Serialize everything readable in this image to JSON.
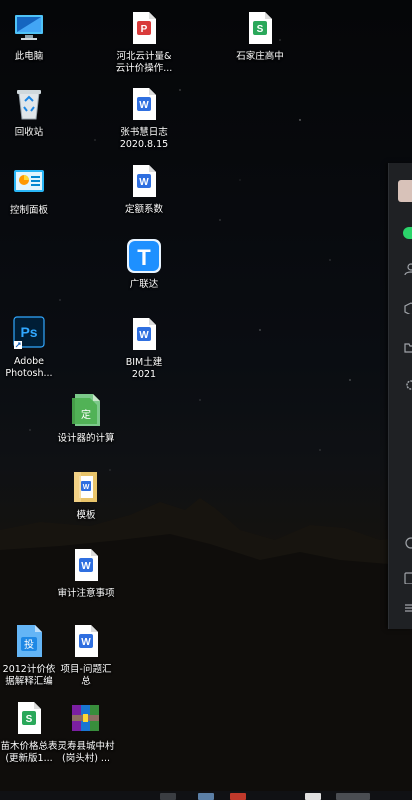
{
  "desktop": {
    "icons": [
      {
        "id": "this-pc",
        "label": "此电脑"
      },
      {
        "id": "recycle-bin",
        "label": "回收站"
      },
      {
        "id": "control-panel",
        "label": "控制面板"
      },
      {
        "id": "photoshop",
        "label": "Adobe\nPhotosh..."
      },
      {
        "id": "hebei-cloud",
        "label": "河北云计量&\n云计价操作..."
      },
      {
        "id": "zhang-log",
        "label": "张书慧日志\n2020.8.15"
      },
      {
        "id": "quota-coef",
        "label": "定额系数"
      },
      {
        "id": "glodon",
        "label": "广联达"
      },
      {
        "id": "bim",
        "label": "BIM土建\n2021"
      },
      {
        "id": "design-calc",
        "label": "设计器的计算"
      },
      {
        "id": "template",
        "label": "模板"
      },
      {
        "id": "audit-notes",
        "label": "审计注意事项"
      },
      {
        "id": "shijiazhuang",
        "label": "石家庄高中"
      },
      {
        "id": "pricing-2012",
        "label": "2012计价依\n据解释汇编"
      },
      {
        "id": "project-issues",
        "label": "项目-问题汇\n总"
      },
      {
        "id": "seedling-price",
        "label": "苗木价格总表\n(更新版1..."
      },
      {
        "id": "lingshou",
        "label": "灵寿县城中村\n(岗头村) ..."
      }
    ]
  },
  "colors": {
    "wps_doc": "#2f6fe0",
    "wps_sheet": "#2aa85a",
    "wps_pdf": "#d93b3b",
    "ps_bg": "#001e36",
    "ps_text": "#31a8ff",
    "glodon": "#1e90ff",
    "panel_green": "#2bd36a"
  }
}
